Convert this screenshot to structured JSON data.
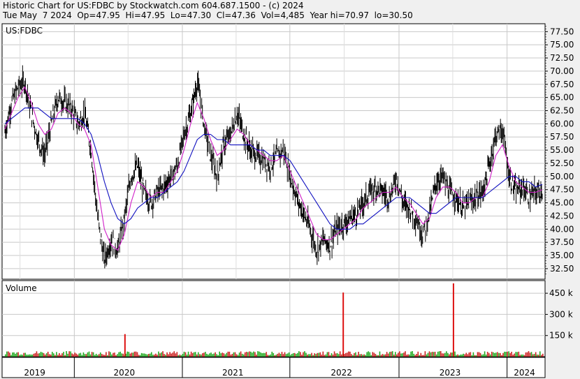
{
  "header": {
    "line1": "Historic Chart for US:FDBC by Stockwatch.com 604.687.1500 - (c) 2024",
    "line2": "Tue May  7 2024  Op=47.95  Hi=47.95  Lo=47.30  Cl=47.36  Vol=4,485  Year hi=70.97  lo=30.50"
  },
  "chart_data": [
    {
      "type": "line",
      "panel": "price",
      "title": "US:FDBC",
      "ylim": [
        30.5,
        79.0
      ],
      "y_ticks": [
        "32.50",
        "35.00",
        "37.50",
        "40.00",
        "42.50",
        "45.00",
        "47.50",
        "50.00",
        "52.50",
        "55.00",
        "57.50",
        "60.00",
        "62.50",
        "65.00",
        "67.50",
        "70.00",
        "72.50",
        "75.00",
        "77.50"
      ],
      "x_ticks": [
        "2019",
        "2020",
        "2021",
        "2022",
        "2023",
        "2024"
      ],
      "grid": true,
      "series": [
        {
          "values": [
            58.5,
            64,
            67,
            68,
            62,
            57,
            54,
            60,
            65,
            64,
            63,
            60,
            62,
            55,
            42,
            34,
            38,
            36,
            42,
            50,
            52,
            47,
            45,
            47,
            48,
            50,
            52,
            58,
            62,
            68,
            60,
            54,
            50,
            56,
            58,
            62,
            58,
            55,
            54,
            53,
            52,
            54,
            55,
            50,
            46,
            43,
            40,
            36,
            38,
            37,
            40,
            41,
            42,
            43,
            45,
            47,
            48,
            47,
            46,
            50,
            45,
            44,
            42,
            39,
            43,
            49,
            50,
            47,
            46,
            44,
            45,
            46,
            47,
            52,
            58,
            59,
            50,
            47,
            48,
            46,
            47,
            47.4
          ]
        },
        {
          "values": [
            59,
            62,
            65,
            67,
            64,
            60,
            58,
            59,
            62,
            63,
            62,
            60,
            59,
            56,
            48,
            40,
            37,
            36,
            39,
            45,
            49,
            48,
            46,
            47,
            47,
            49,
            51,
            55,
            60,
            64,
            61,
            57,
            54,
            55,
            57,
            59,
            58,
            56,
            55,
            54,
            53,
            53,
            54,
            51,
            48,
            45,
            42,
            39,
            38,
            38,
            39,
            40,
            41,
            42,
            44,
            45,
            46,
            47,
            47,
            48,
            46,
            45,
            43,
            41,
            42,
            46,
            48,
            48,
            47,
            45,
            45,
            46,
            46,
            49,
            54,
            56,
            52,
            49,
            48,
            47,
            47,
            47.5
          ]
        },
        {
          "values": [
            60,
            61,
            62,
            63,
            63,
            63,
            62,
            61,
            61,
            61,
            61,
            61,
            60,
            58,
            54,
            49,
            45,
            42,
            41,
            42,
            44,
            45,
            46,
            46,
            47,
            48,
            49,
            51,
            54,
            57,
            58,
            58,
            57,
            57,
            56,
            56,
            56,
            56,
            55,
            55,
            54,
            54,
            54,
            53,
            51,
            49,
            47,
            45,
            43,
            41,
            40,
            40,
            40,
            41,
            41,
            42,
            43,
            44,
            45,
            46,
            46,
            46,
            45,
            44,
            43,
            43,
            44,
            45,
            46,
            46,
            46,
            46,
            46,
            47,
            48,
            49,
            50,
            50,
            49,
            49,
            48,
            48.5
          ]
        }
      ]
    },
    {
      "type": "bar",
      "panel": "volume",
      "title": "Volume",
      "ylim": [
        0,
        520
      ],
      "y_ticks": [
        "150 k",
        "300 k",
        "450 k"
      ],
      "x_ticks": [
        "2019",
        "2020",
        "2021",
        "2022",
        "2023",
        "2024"
      ],
      "spikes": [
        {
          "period": "2020",
          "value": 160
        },
        {
          "period": "2022",
          "value": 455
        },
        {
          "period": "2023",
          "value": 520
        }
      ]
    }
  ]
}
